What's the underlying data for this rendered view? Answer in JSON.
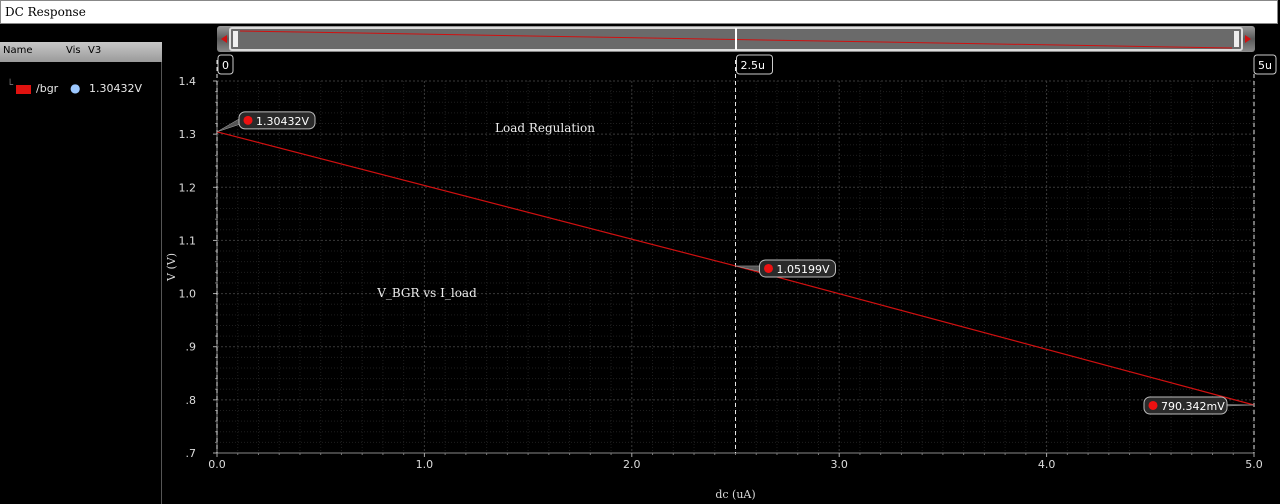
{
  "window": {
    "title": "DC Response"
  },
  "legend": {
    "columns": [
      "Name",
      "Vis",
      "V3"
    ],
    "signals": [
      {
        "name": "/bgr",
        "value": "1.30432V",
        "color": "#e0120f",
        "visible_icon": "eye-icon"
      }
    ]
  },
  "cursor_labels": [
    "0",
    "2.5u",
    "5u"
  ],
  "markers": [
    {
      "x": 0.0,
      "y": 1.30432,
      "label": "1.30432V"
    },
    {
      "x": 2.5,
      "y": 1.05199,
      "label": "1.05199V"
    },
    {
      "x": 5.0,
      "y": 0.790342,
      "label": "790.342mV"
    }
  ],
  "chart_data": {
    "type": "line",
    "annotations": [
      "Load Regulation",
      "V_BGR vs I_load"
    ],
    "xlabel": "dc (uA)",
    "ylabel": "V (V)",
    "xlim": [
      0,
      5
    ],
    "ylim": [
      0.7,
      1.4
    ],
    "x_ticks": [
      "0.0",
      "1.0",
      "2.0",
      "3.0",
      "4.0",
      "5.0"
    ],
    "y_ticks": [
      "1.4",
      "1.3",
      "1.2",
      "1.1",
      "1.0",
      ".9",
      ".8",
      ".7"
    ],
    "grid": true,
    "series": [
      {
        "name": "/bgr",
        "color": "#d01010",
        "x": [
          0,
          2.5,
          5
        ],
        "y": [
          1.30432,
          1.05199,
          0.790342
        ]
      }
    ]
  }
}
